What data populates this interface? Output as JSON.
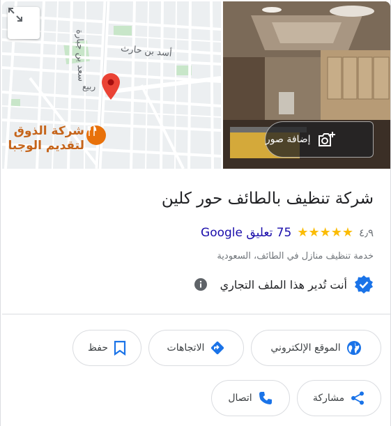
{
  "map": {
    "street_1": "سعد بن جبارة",
    "street_2": "أسد بن حارث",
    "poi_short": "ربيع",
    "poi_name_line1": "شركة الذوق",
    "poi_name_line2": "لتقديم الوجبا",
    "pin_color": "#ea4335",
    "poi_color": "#c5641a"
  },
  "photo": {
    "add_photo_label": "إضافة صور"
  },
  "business": {
    "name": "شركة تنظيف بالطائف حور كلين",
    "rating": "٤٫٩",
    "stars": 5,
    "reviews_label": "75 تعليق Google",
    "category": "خدمة تنظيف منازل في الطائف، السعودية",
    "own_profile": "أنت تُدير هذا الملف التجاري"
  },
  "actions": {
    "website": "الموقع الإلكتروني",
    "directions": "الاتجاهات",
    "save": "حفظ",
    "share": "مشاركة",
    "call": "اتصال"
  },
  "colors": {
    "accent": "#1a73e8",
    "star": "#fbbc04",
    "link": "#1a0dab"
  }
}
